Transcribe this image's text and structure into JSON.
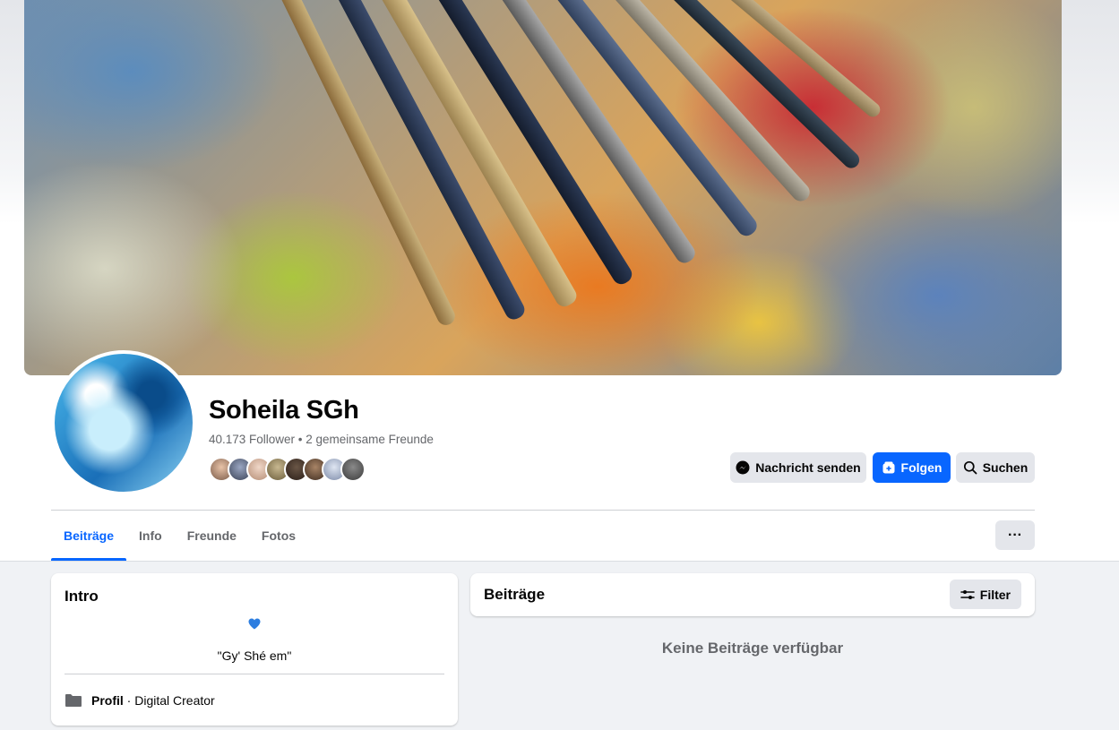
{
  "profile": {
    "name": "Soheila SGh",
    "meta": "40.173 Follower • 2 gemeinsame Freunde"
  },
  "actions": {
    "message_label": "Nachricht senden",
    "follow_label": "Folgen",
    "search_label": "Suchen"
  },
  "tabs": [
    {
      "label": "Beiträge",
      "active": true
    },
    {
      "label": "Info",
      "active": false
    },
    {
      "label": "Freunde",
      "active": false
    },
    {
      "label": "Fotos",
      "active": false
    }
  ],
  "more_label": "···",
  "intro": {
    "title": "Intro",
    "bio": "\"Gy' Shé em\"",
    "detail_bold": "Profil",
    "detail_rest": " · Digital Creator"
  },
  "posts": {
    "title": "Beiträge",
    "filter_label": "Filter",
    "empty_text": "Keine Beiträge verfügbar"
  },
  "colors": {
    "accent": "#0866ff",
    "secondary_button": "#e4e6eb",
    "page_background": "#f0f2f5"
  }
}
